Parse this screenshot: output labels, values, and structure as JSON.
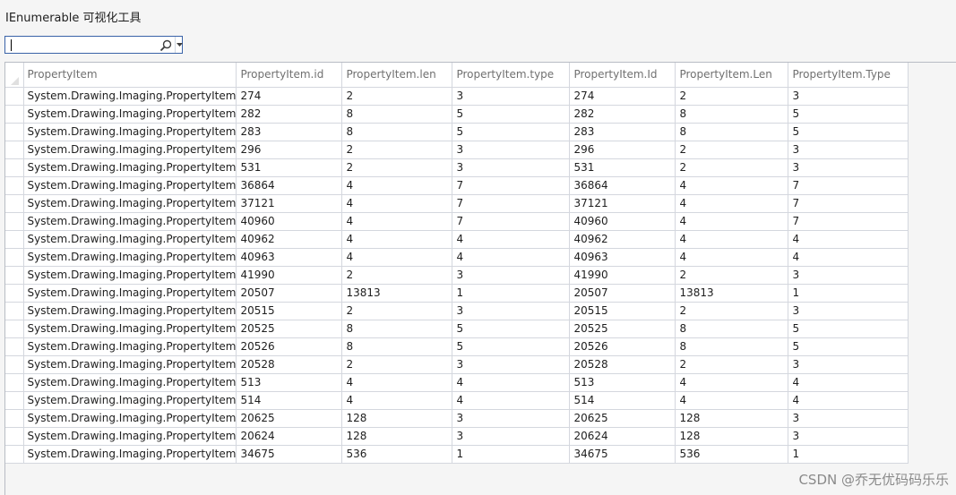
{
  "window": {
    "title": "IEnumerable 可视化工具"
  },
  "search": {
    "value": "",
    "placeholder": ""
  },
  "icons": {
    "search": "search-icon",
    "dropdown": "chevron-down-icon",
    "corner": "select-all-icon"
  },
  "grid": {
    "columns": [
      "PropertyItem",
      "PropertyItem.id",
      "PropertyItem.len",
      "PropertyItem.type",
      "PropertyItem.Id",
      "PropertyItem.Len",
      "PropertyItem.Type"
    ],
    "rows": [
      [
        "System.Drawing.Imaging.PropertyItem",
        "274",
        "2",
        "3",
        "274",
        "2",
        "3"
      ],
      [
        "System.Drawing.Imaging.PropertyItem",
        "282",
        "8",
        "5",
        "282",
        "8",
        "5"
      ],
      [
        "System.Drawing.Imaging.PropertyItem",
        "283",
        "8",
        "5",
        "283",
        "8",
        "5"
      ],
      [
        "System.Drawing.Imaging.PropertyItem",
        "296",
        "2",
        "3",
        "296",
        "2",
        "3"
      ],
      [
        "System.Drawing.Imaging.PropertyItem",
        "531",
        "2",
        "3",
        "531",
        "2",
        "3"
      ],
      [
        "System.Drawing.Imaging.PropertyItem",
        "36864",
        "4",
        "7",
        "36864",
        "4",
        "7"
      ],
      [
        "System.Drawing.Imaging.PropertyItem",
        "37121",
        "4",
        "7",
        "37121",
        "4",
        "7"
      ],
      [
        "System.Drawing.Imaging.PropertyItem",
        "40960",
        "4",
        "7",
        "40960",
        "4",
        "7"
      ],
      [
        "System.Drawing.Imaging.PropertyItem",
        "40962",
        "4",
        "4",
        "40962",
        "4",
        "4"
      ],
      [
        "System.Drawing.Imaging.PropertyItem",
        "40963",
        "4",
        "4",
        "40963",
        "4",
        "4"
      ],
      [
        "System.Drawing.Imaging.PropertyItem",
        "41990",
        "2",
        "3",
        "41990",
        "2",
        "3"
      ],
      [
        "System.Drawing.Imaging.PropertyItem",
        "20507",
        "13813",
        "1",
        "20507",
        "13813",
        "1"
      ],
      [
        "System.Drawing.Imaging.PropertyItem",
        "20515",
        "2",
        "3",
        "20515",
        "2",
        "3"
      ],
      [
        "System.Drawing.Imaging.PropertyItem",
        "20525",
        "8",
        "5",
        "20525",
        "8",
        "5"
      ],
      [
        "System.Drawing.Imaging.PropertyItem",
        "20526",
        "8",
        "5",
        "20526",
        "8",
        "5"
      ],
      [
        "System.Drawing.Imaging.PropertyItem",
        "20528",
        "2",
        "3",
        "20528",
        "2",
        "3"
      ],
      [
        "System.Drawing.Imaging.PropertyItem",
        "513",
        "4",
        "4",
        "513",
        "4",
        "4"
      ],
      [
        "System.Drawing.Imaging.PropertyItem",
        "514",
        "4",
        "4",
        "514",
        "4",
        "4"
      ],
      [
        "System.Drawing.Imaging.PropertyItem",
        "20625",
        "128",
        "3",
        "20625",
        "128",
        "3"
      ],
      [
        "System.Drawing.Imaging.PropertyItem",
        "20624",
        "128",
        "3",
        "20624",
        "128",
        "3"
      ],
      [
        "System.Drawing.Imaging.PropertyItem",
        "34675",
        "536",
        "1",
        "34675",
        "536",
        "1"
      ]
    ]
  },
  "watermark": "CSDN @乔无优码码乐乐"
}
